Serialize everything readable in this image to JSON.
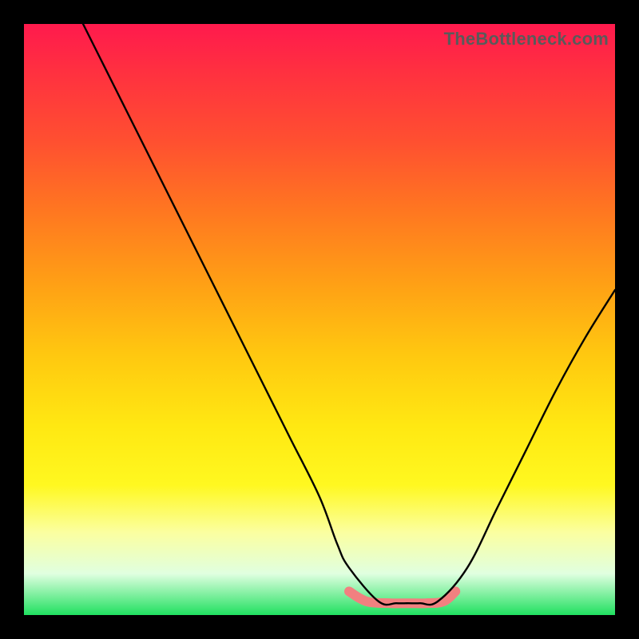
{
  "watermark": "TheBottleneck.com",
  "chart_data": {
    "type": "line",
    "title": "",
    "xlabel": "",
    "ylabel": "",
    "xlim": [
      0,
      100
    ],
    "ylim": [
      0,
      100
    ],
    "series": [
      {
        "name": "black-curve",
        "color": "#000000",
        "x": [
          10,
          15,
          20,
          25,
          30,
          35,
          40,
          45,
          50,
          53,
          55,
          60,
          63,
          65,
          67,
          70,
          75,
          80,
          85,
          90,
          95,
          100
        ],
        "values": [
          100,
          90,
          80,
          70,
          60,
          50,
          40,
          30,
          20,
          12,
          8,
          2.3,
          2.0,
          2.0,
          2.0,
          2.3,
          8,
          18,
          28,
          38,
          47,
          55
        ]
      },
      {
        "name": "pink-band",
        "color": "#f28080",
        "x": [
          55,
          58,
          62,
          65,
          68,
          71,
          73
        ],
        "values": [
          4.0,
          2.3,
          2.0,
          2.0,
          2.0,
          2.3,
          4.0
        ]
      }
    ]
  }
}
